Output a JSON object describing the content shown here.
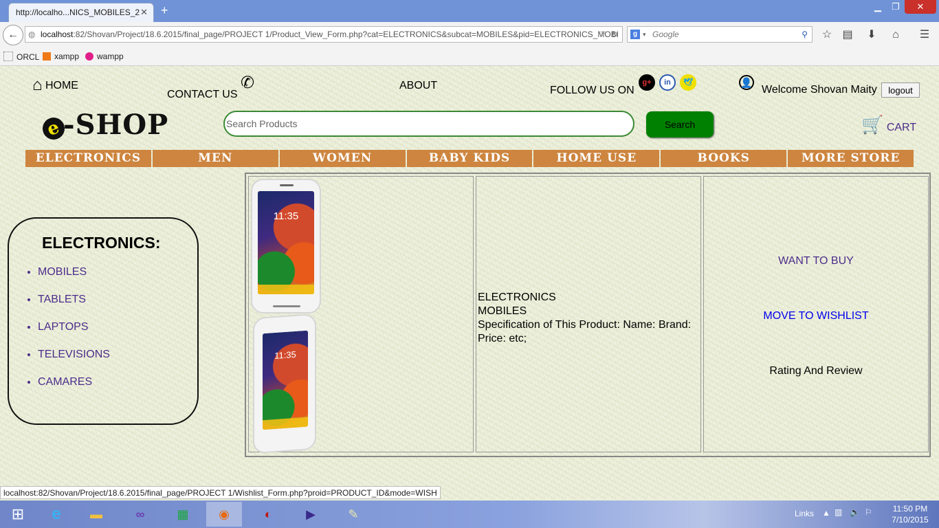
{
  "browser": {
    "tab_title": "http://localho...NICS_MOBILES_2",
    "url_host": "localhost",
    "url_rest": ":82/Shovan/Project/18.6.2015/final_page/PROJECT 1/Product_View_Form.php?cat=ELECTRONICS&subcat=MOBILES&pid=ELECTRONICS_MOBI",
    "search_placeholder": "Google",
    "bookmarks": [
      "ORCL",
      "xampp",
      "wampp"
    ]
  },
  "header": {
    "home": "HOME",
    "contact": "CONTACT US",
    "about": "ABOUT",
    "follow": "FOLLOW US ON",
    "welcome": "Welcome Shovan Maity",
    "logout": "logout",
    "logo": "-SHOP",
    "search_placeholder": "Search Products",
    "search_button": "Search",
    "cart": "CART"
  },
  "menu": [
    "ELECTRONICS",
    "MEN",
    "WOMEN",
    "BABY KIDS",
    "HOME USE",
    "BOOKS",
    "MORE STORE"
  ],
  "sidebar": {
    "title": "ELECTRONICS:",
    "items": [
      "MOBILES",
      "TABLETS",
      "LAPTOPS",
      "TELEVISIONS",
      "CAMARES"
    ]
  },
  "product": {
    "category": "ELECTRONICS",
    "subcategory": "MOBILES",
    "spec": "Specification of This Product: Name: Brand: Price: etc;",
    "screen_time": "11:35",
    "want_to_buy": "WANT TO BUY",
    "move_to_wishlist": "MOVE TO WISHLIST",
    "rating_review": "Rating And Review"
  },
  "status_url": "localhost:82/Shovan/Project/18.6.2015/final_page/PROJECT 1/Wishlist_Form.php?proid=PRODUCT_ID&mode=WISH",
  "taskbar": {
    "links": "Links",
    "time": "11:50 PM",
    "date": "7/10/2015"
  },
  "colors": {
    "menu_bg": "#cd853f",
    "search_button": "#008000",
    "link_purple": "#4b2c8c",
    "link_blue": "#0000ee"
  }
}
